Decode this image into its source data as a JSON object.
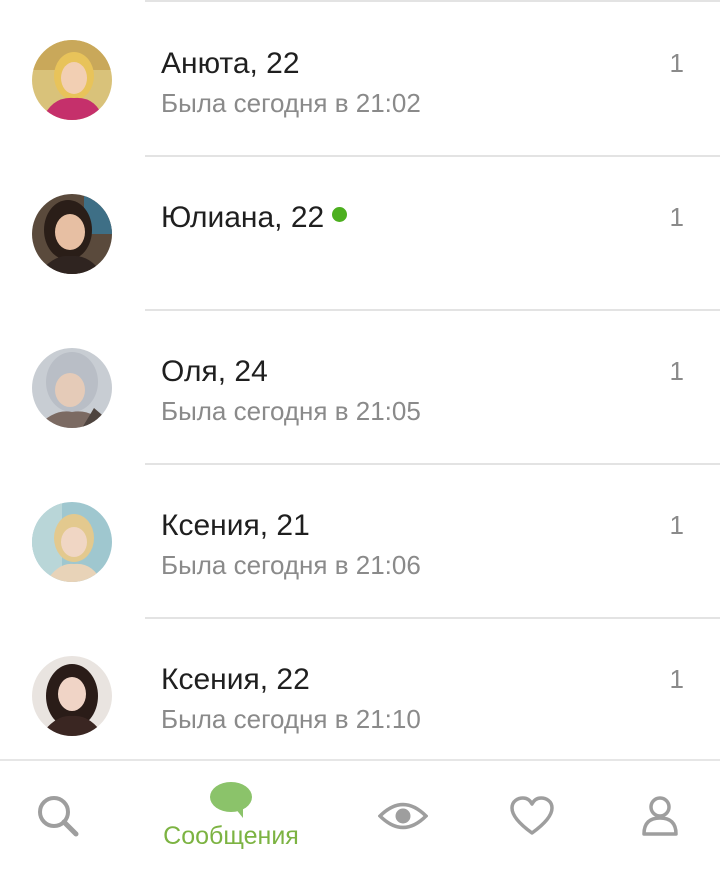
{
  "colors": {
    "accent": "#7cb342",
    "online": "#4caf1f",
    "inactive_icon": "#9e9e9e",
    "name_text": "#1f1f1f",
    "status_text": "#8a8a8a"
  },
  "contacts": [
    {
      "name": "Анюта, 22",
      "status": "Была сегодня в 21:02",
      "count": "1",
      "online": false
    },
    {
      "name": "Юлиана, 22",
      "status": "",
      "count": "1",
      "online": true
    },
    {
      "name": "Оля, 24",
      "status": "Была сегодня в 21:05",
      "count": "1",
      "online": false
    },
    {
      "name": "Ксения, 21",
      "status": "Была сегодня в 21:06",
      "count": "1",
      "online": false
    },
    {
      "name": "Ксения, 22",
      "status": "Была сегодня в 21:10",
      "count": "1",
      "online": false
    }
  ],
  "bottom_nav": [
    {
      "icon": "search-icon",
      "label": "",
      "active": false
    },
    {
      "icon": "chat-bubble-icon",
      "label": "Сообщения",
      "active": true
    },
    {
      "icon": "eye-icon",
      "label": "",
      "active": false
    },
    {
      "icon": "heart-icon",
      "label": "",
      "active": false
    },
    {
      "icon": "profile-icon",
      "label": "",
      "active": false
    }
  ]
}
